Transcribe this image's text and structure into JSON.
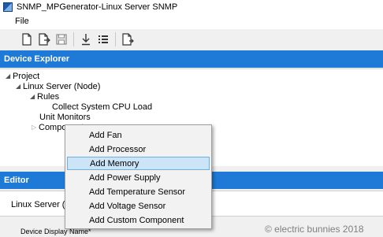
{
  "window": {
    "title": "SNMP_MPGenerator-Linux Server SNMP"
  },
  "menu": {
    "file_label": "File"
  },
  "toolbar": {
    "buttons": [
      {
        "icon": "new-document-icon"
      },
      {
        "icon": "export-document-icon"
      },
      {
        "icon": "save-icon"
      },
      {
        "icon": "download-icon"
      },
      {
        "icon": "list-icon"
      },
      {
        "icon": "generate-document-icon"
      }
    ]
  },
  "device_explorer": {
    "header": "Device Explorer",
    "tree": {
      "project": "Project",
      "linux_server": "Linux Server (Node)",
      "rules": "Rules",
      "collect_cpu": "Collect System CPU Load",
      "unit_monitors": "Unit Monitors",
      "components": "Components"
    }
  },
  "context_menu": {
    "items": [
      "Add Fan",
      "Add Processor",
      "Add Memory",
      "Add Power Supply",
      "Add Temperature Sensor",
      "Add Voltage Sensor",
      "Add Custom Component"
    ],
    "highlighted": "Add Memory"
  },
  "editor": {
    "header": "Editor",
    "field_label": "Linux Server (Node)",
    "device_display_label": "Device Display Name*"
  },
  "watermark": "© electric bunnies 2018",
  "colors": {
    "header_blue": "#1e7ad6",
    "highlight": "#cce4f7"
  }
}
